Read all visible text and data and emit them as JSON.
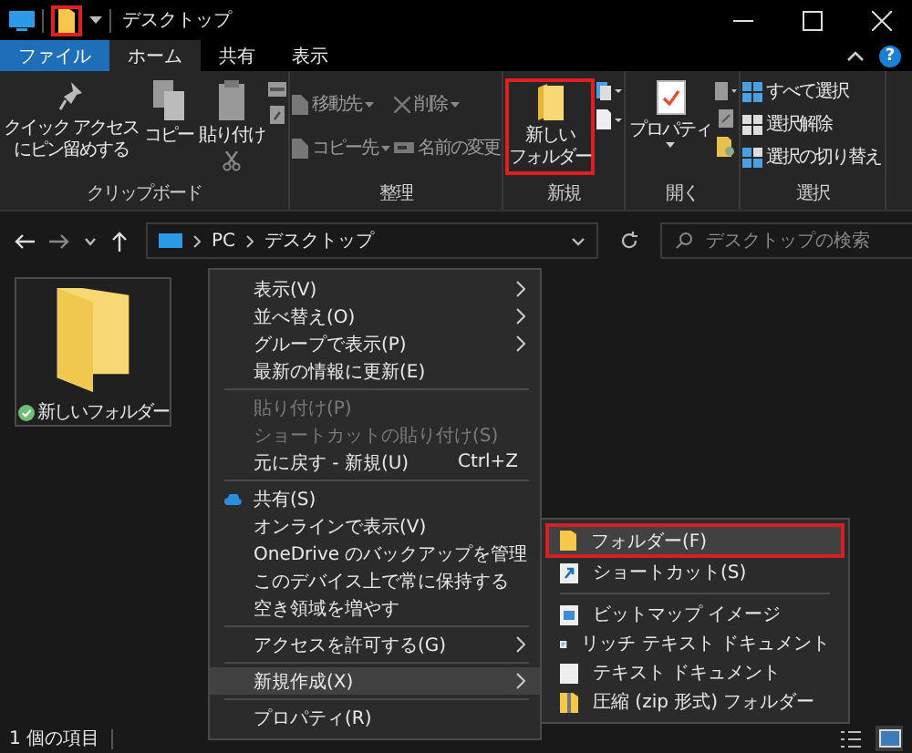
{
  "window": {
    "title": "デスクトップ",
    "quick_access_highlighted": true
  },
  "tabs": [
    {
      "label": "ファイル",
      "kind": "file",
      "selected": false
    },
    {
      "label": "ホーム",
      "kind": "tab",
      "selected": true
    },
    {
      "label": "共有",
      "kind": "tab",
      "selected": false
    },
    {
      "label": "表示",
      "kind": "tab",
      "selected": false
    }
  ],
  "help_label": "?",
  "ribbon": {
    "clipboard": {
      "label": "クリップボード",
      "pin": [
        "クイック アクセス",
        "にピン留めする"
      ],
      "copy": "コピー",
      "paste": "貼り付け"
    },
    "organize": {
      "label": "整理",
      "items": [
        {
          "label": "移動先",
          "dropdown": true,
          "disabled": true
        },
        {
          "label": "コピー先",
          "dropdown": true,
          "disabled": true
        },
        {
          "label": "削除",
          "dropdown": true,
          "disabled": true
        },
        {
          "label": "名前の変更",
          "dropdown": false,
          "disabled": true
        }
      ]
    },
    "new": {
      "label": "新規",
      "button": [
        "新しい",
        "フォルダー"
      ],
      "highlighted": true
    },
    "open": {
      "label": "開く",
      "button": "プロパティ"
    },
    "select": {
      "label": "選択",
      "items": [
        "すべて選択",
        "選択解除",
        "選択の切り替え"
      ]
    }
  },
  "address": {
    "crumbs": [
      "PC",
      "デスクトップ"
    ],
    "search_placeholder": "デスクトップの検索"
  },
  "files": [
    {
      "label": "新しいフォルダー",
      "selected": true,
      "synced": true
    }
  ],
  "context_menu": [
    {
      "kind": "item",
      "label": "表示(V)",
      "submenu": true,
      "disabled": false,
      "selected": false
    },
    {
      "kind": "item",
      "label": "並べ替え(O)",
      "submenu": true,
      "disabled": false,
      "selected": false
    },
    {
      "kind": "item",
      "label": "グループで表示(P)",
      "submenu": true,
      "disabled": false,
      "selected": false
    },
    {
      "kind": "item",
      "label": "最新の情報に更新(E)",
      "submenu": false,
      "disabled": false,
      "selected": false
    },
    {
      "kind": "separator"
    },
    {
      "kind": "item",
      "label": "貼り付け(P)",
      "submenu": false,
      "disabled": true,
      "selected": false
    },
    {
      "kind": "item",
      "label": "ショートカットの貼り付け(S)",
      "submenu": false,
      "disabled": true,
      "selected": false
    },
    {
      "kind": "item",
      "label": "元に戻す - 新規(U)",
      "shortcut": "Ctrl+Z",
      "submenu": false,
      "disabled": false,
      "selected": false
    },
    {
      "kind": "separator"
    },
    {
      "kind": "cloud",
      "label": "共有(S)",
      "submenu": false,
      "disabled": false,
      "selected": false
    },
    {
      "kind": "item",
      "label": "オンラインで表示(V)",
      "submenu": false,
      "disabled": false,
      "selected": false
    },
    {
      "kind": "item",
      "label": "OneDrive のバックアップを管理",
      "submenu": false,
      "disabled": false,
      "selected": false
    },
    {
      "kind": "item",
      "label": "このデバイス上で常に保持する",
      "submenu": false,
      "disabled": false,
      "selected": false
    },
    {
      "kind": "item",
      "label": "空き領域を増やす",
      "submenu": false,
      "disabled": false,
      "selected": false
    },
    {
      "kind": "separator"
    },
    {
      "kind": "item",
      "label": "アクセスを許可する(G)",
      "submenu": true,
      "disabled": false,
      "selected": false
    },
    {
      "kind": "separator"
    },
    {
      "kind": "item",
      "label": "新規作成(X)",
      "submenu": true,
      "disabled": false,
      "selected": true
    },
    {
      "kind": "separator"
    },
    {
      "kind": "item",
      "label": "プロパティ(R)",
      "submenu": false,
      "disabled": false,
      "selected": false
    }
  ],
  "submenu": [
    {
      "kind": "folder",
      "label": "フォルダー(F)",
      "highlighted": true
    },
    {
      "kind": "shortcut",
      "label": "ショートカット(S)",
      "highlighted": false
    },
    {
      "kind": "separator"
    },
    {
      "kind": "bitmap",
      "label": "ビットマップ イメージ",
      "highlighted": false
    },
    {
      "kind": "rtf",
      "label": "リッチ テキスト ドキュメント",
      "highlighted": false
    },
    {
      "kind": "text",
      "label": "テキスト ドキュメント",
      "highlighted": false
    },
    {
      "kind": "zip",
      "label": "圧縮 (zip 形式) フォルダー",
      "highlighted": false
    }
  ],
  "status_bar": {
    "count": "1 個の項目",
    "views": [
      {
        "kind": "details",
        "selected": false
      },
      {
        "kind": "large-icons",
        "selected": true
      }
    ]
  }
}
